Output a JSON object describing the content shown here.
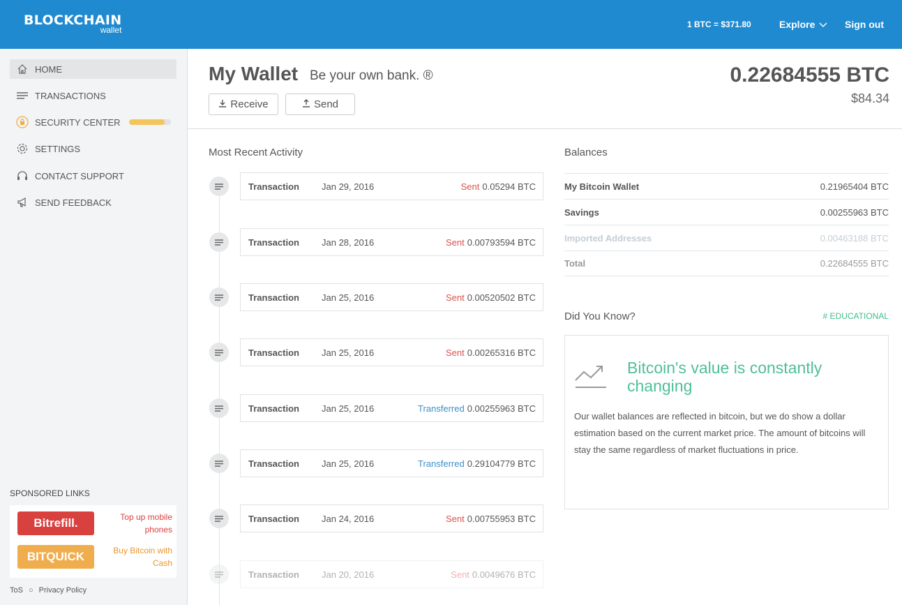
{
  "header": {
    "logo_main": "BLOCKCHAIN",
    "logo_sub": "wallet",
    "rate": "1 BTC = $371.80",
    "explore_label": "Explore",
    "signout_label": "Sign out",
    "brand_color": "#1f8ad0"
  },
  "sidebar": {
    "items": [
      {
        "label": "HOME",
        "icon": "home-icon",
        "active": true
      },
      {
        "label": "TRANSACTIONS",
        "icon": "list-icon"
      },
      {
        "label": "SECURITY CENTER",
        "icon": "lock-icon",
        "progress": 0.85
      },
      {
        "label": "SETTINGS",
        "icon": "gear-icon"
      },
      {
        "label": "CONTACT SUPPORT",
        "icon": "headset-icon"
      },
      {
        "label": "SEND FEEDBACK",
        "icon": "megaphone-icon"
      }
    ],
    "sponsored_title": "SPONSORED LINKS",
    "sponsors": [
      {
        "logo": "Bitrefill.",
        "text_line1": "Top up mobile",
        "text_line2": "phones",
        "color": "#d9413f"
      },
      {
        "logo": "BITQUICK",
        "text_line1": "Buy Bitcoin with",
        "text_line2": "Cash",
        "color": "#f0ad4e"
      }
    ],
    "footer": {
      "tos": "ToS",
      "privacy": "Privacy Policy"
    }
  },
  "main": {
    "title": "My Wallet",
    "tagline": "Be your own bank. ®",
    "receive_label": "Receive",
    "send_label": "Send",
    "balance_btc": "0.22684555 BTC",
    "balance_usd": "$84.34"
  },
  "activity": {
    "title": "Most Recent Activity",
    "transactions": [
      {
        "type": "Transaction",
        "date": "Jan 29, 2016",
        "direction": "Sent",
        "amount": "0.05294 BTC"
      },
      {
        "type": "Transaction",
        "date": "Jan 28, 2016",
        "direction": "Sent",
        "amount": "0.00793594 BTC"
      },
      {
        "type": "Transaction",
        "date": "Jan 25, 2016",
        "direction": "Sent",
        "amount": "0.00520502 BTC"
      },
      {
        "type": "Transaction",
        "date": "Jan 25, 2016",
        "direction": "Sent",
        "amount": "0.00265316 BTC"
      },
      {
        "type": "Transaction",
        "date": "Jan 25, 2016",
        "direction": "Transferred",
        "amount": "0.00255963 BTC"
      },
      {
        "type": "Transaction",
        "date": "Jan 25, 2016",
        "direction": "Transferred",
        "amount": "0.29104779 BTC"
      },
      {
        "type": "Transaction",
        "date": "Jan 24, 2016",
        "direction": "Sent",
        "amount": "0.00755953 BTC"
      },
      {
        "type": "Transaction",
        "date": "Jan 20, 2016",
        "direction": "Sent",
        "amount": "0.0049676 BTC"
      }
    ],
    "sent_color": "#d9534f",
    "transferred_color": "#3b8fc9"
  },
  "balances": {
    "title": "Balances",
    "rows": [
      {
        "name": "My Bitcoin Wallet",
        "value": "0.21965404 BTC"
      },
      {
        "name": "Savings",
        "value": "0.00255963 BTC"
      },
      {
        "name": "Imported Addresses",
        "value": "0.00463188 BTC"
      },
      {
        "name": "Total",
        "value": "0.22684555 BTC"
      }
    ]
  },
  "did_you_know": {
    "title": "Did You Know?",
    "tag": "# EDUCATIONAL",
    "heading": "Bitcoin's value is constantly changing",
    "body": "Our wallet balances are reflected in bitcoin, but we do show a dollar estimation based on the current market price. The amount of bitcoins will stay the same regardless of market fluctuations in price."
  }
}
